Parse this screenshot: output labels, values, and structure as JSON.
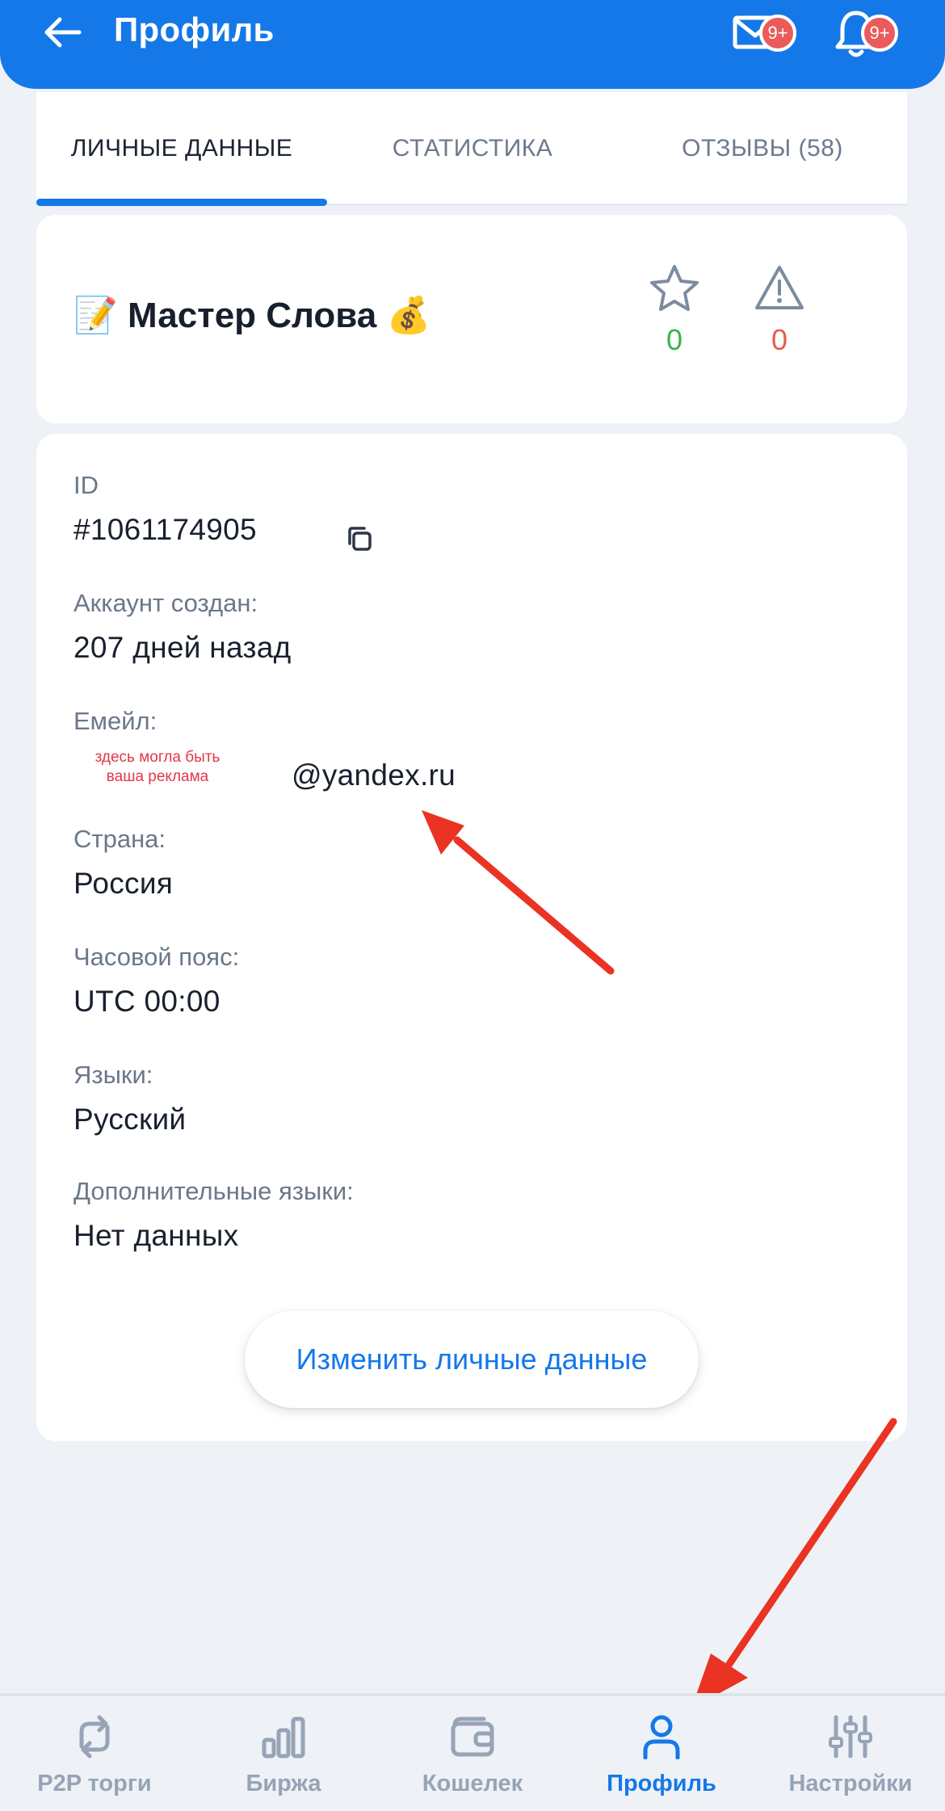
{
  "header": {
    "title": "Профиль",
    "mail_badge": "9+",
    "bell_badge": "9+"
  },
  "tabs": [
    {
      "label": "ЛИЧНЫЕ ДАННЫЕ",
      "active": true
    },
    {
      "label": "СТАТИСТИКА",
      "active": false
    },
    {
      "label": "ОТЗЫВЫ (58)",
      "active": false
    }
  ],
  "profile": {
    "name_prefix_emoji": "📝",
    "name": "Мастер Слова",
    "name_suffix_emoji": "💰",
    "likes": "0",
    "complaints": "0"
  },
  "info": {
    "id_label": "ID",
    "id_value": "#1061174905",
    "created_label": "Аккаунт создан:",
    "created_value": "207 дней назад",
    "email_label": "Емейл:",
    "email_value": "@yandex.ru",
    "ad_note": "здесь могла быть ваша реклама",
    "country_label": "Страна:",
    "country_value": "Россия",
    "timezone_label": "Часовой пояс:",
    "timezone_value": "UTC 00:00",
    "languages_label": "Языки:",
    "languages_value": "Русский",
    "extra_languages_label": "Дополнительные языки:",
    "extra_languages_value": "Нет данных",
    "edit_button": "Изменить личные данные"
  },
  "bottom_nav": [
    {
      "label": "P2P торги",
      "icon": "p2p-arrows-icon",
      "active": false
    },
    {
      "label": "Биржа",
      "icon": "bar-chart-icon",
      "active": false
    },
    {
      "label": "Кошелек",
      "icon": "wallet-icon",
      "active": false
    },
    {
      "label": "Профиль",
      "icon": "person-icon",
      "active": true
    },
    {
      "label": "Настройки",
      "icon": "sliders-icon",
      "active": false
    }
  ],
  "colors": {
    "accent": "#1478e8",
    "badge": "#ec5b5b",
    "like": "#3bb34a",
    "complaint": "#e95b4b",
    "annotation_arrow": "#ea3323"
  }
}
